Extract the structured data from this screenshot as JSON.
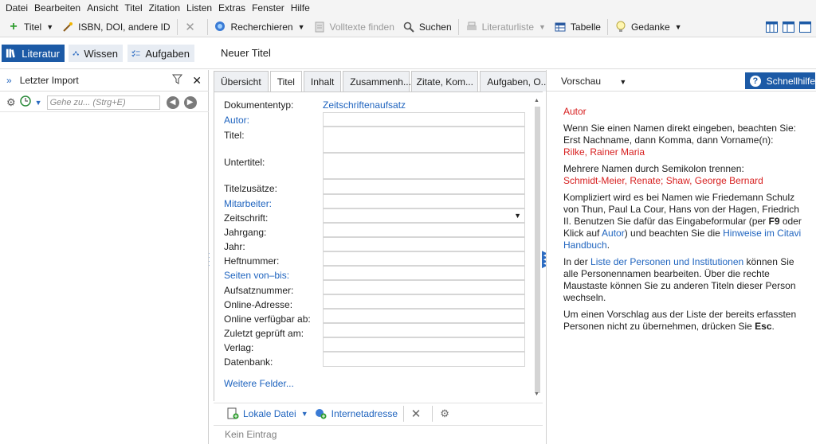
{
  "menu": [
    "Datei",
    "Bearbeiten",
    "Ansicht",
    "Titel",
    "Zitation",
    "Listen",
    "Extras",
    "Fenster",
    "Hilfe"
  ],
  "toolbar": {
    "titel": "Titel",
    "isbn": "ISBN, DOI, andere ID",
    "recherchieren": "Recherchieren",
    "volltexte": "Volltexte finden",
    "suchen": "Suchen",
    "literaturliste": "Literaturliste",
    "tabelle": "Tabelle",
    "gedanke": "Gedanke"
  },
  "nav": {
    "literatur": "Literatur",
    "wissen": "Wissen",
    "aufgaben": "Aufgaben",
    "title": "Neuer Titel"
  },
  "left": {
    "header": "Letzter Import",
    "search_placeholder": "Gehe zu... (Strg+E)"
  },
  "tabs": [
    "Übersicht",
    "Titel",
    "Inhalt",
    "Zusammenh...",
    "Zitate, Kom...",
    "Aufgaben, O..."
  ],
  "form": {
    "doctype_label": "Dokumententyp:",
    "doctype_value": "Zeitschriftenaufsatz",
    "fields": {
      "autor": "Autor:",
      "titel": "Titel:",
      "untertitel": "Untertitel:",
      "titelzusaetze": "Titelzusätze:",
      "mitarbeiter": "Mitarbeiter:",
      "zeitschrift": "Zeitschrift:",
      "jahrgang": "Jahrgang:",
      "jahr": "Jahr:",
      "heftnummer": "Heftnummer:",
      "seiten": "Seiten von–bis:",
      "aufsatznummer": "Aufsatznummer:",
      "online_adresse": "Online-Adresse:",
      "online_verfuegbar": "Online verfügbar ab:",
      "zuletzt": "Zuletzt geprüft am:",
      "verlag": "Verlag:",
      "datenbank": "Datenbank:"
    },
    "weitere": "Weitere Felder..."
  },
  "attach": {
    "lokale_datei": "Lokale Datei",
    "internetadresse": "Internetadresse",
    "kein_eintrag": "Kein Eintrag"
  },
  "right": {
    "vorschau": "Vorschau",
    "schnellhilfe": "Schnellhilfe",
    "help": {
      "heading": "Autor",
      "p1a": "Wenn Sie einen Namen direkt eingeben, beachten Sie:",
      "p1b": "Erst Nachname, dann Komma, dann Vorname(n):",
      "p1c": "Rilke, Rainer Maria",
      "p2a": "Mehrere Namen durch Semikolon trennen:",
      "p2b": "Schmidt-Meier, Renate; Shaw, George Bernard",
      "p3a": "Kompliziert wird es bei Namen wie Friedemann Schulz von Thun, Paul La Cour, Hans von der Hagen, Friedrich II. Benutzen Sie dafür das Eingabeformular (per ",
      "p3b": "F9",
      "p3c": " oder Klick auf ",
      "p3d": "Autor",
      "p3e": ") und beachten Sie die ",
      "p3f": "Hinweise im Citavi Handbuch",
      "p3g": ".",
      "p4a": "In der ",
      "p4b": "Liste der Personen und Institutionen",
      "p4c": " können Sie alle Personennamen bearbeiten. Über die rechte Maustaste können Sie zu anderen Titeln dieser Person wechseln.",
      "p5a": "Um einen Vorschlag aus der Liste der bereits erfassten Personen nicht zu übernehmen, drücken Sie ",
      "p5b": "Esc",
      "p5c": "."
    }
  },
  "colors": {
    "accent": "#1c5aa6",
    "link": "#1f64bf",
    "red": "#d72020"
  }
}
